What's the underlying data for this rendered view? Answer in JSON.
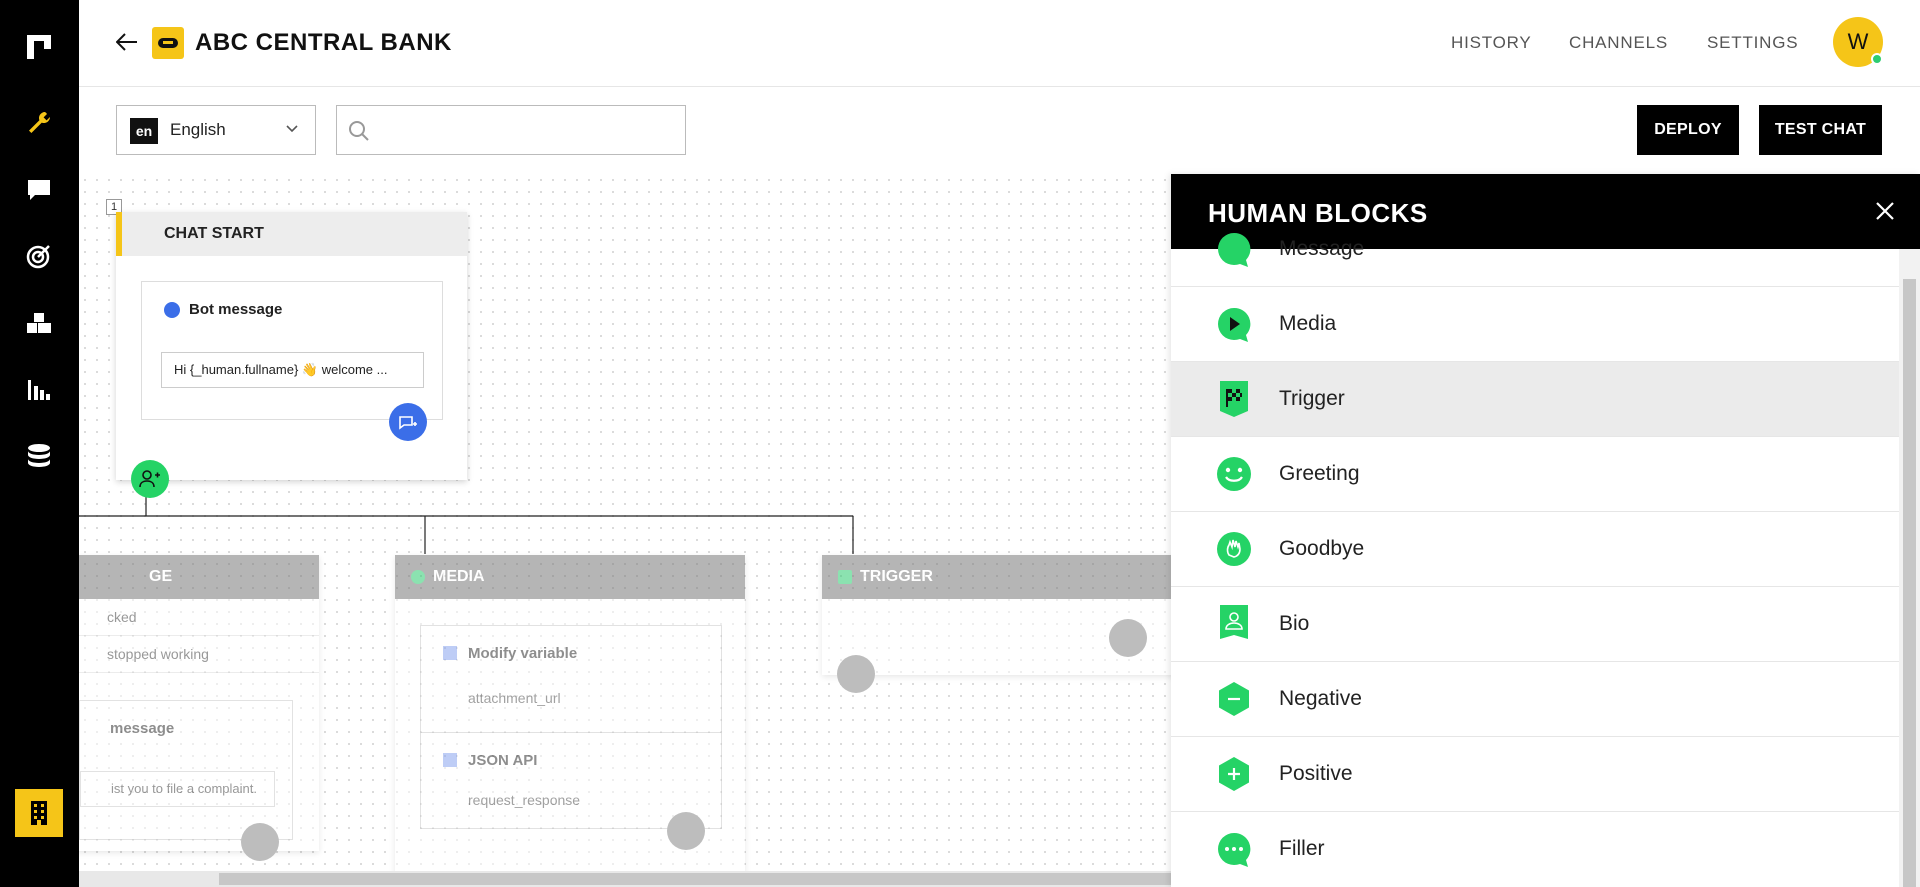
{
  "app": {
    "title": "ABC CENTRAL BANK"
  },
  "nav": {
    "history": "HISTORY",
    "channels": "CHANNELS",
    "settings": "SETTINGS",
    "avatar_initial": "W"
  },
  "toolbar": {
    "language_code": "en",
    "language": "English",
    "search_placeholder": "",
    "deploy": "DEPLOY",
    "test_chat": "TEST CHAT"
  },
  "canvas": {
    "chat_start": {
      "step": "1",
      "title": "CHAT START",
      "card_title": "Bot message",
      "message": "Hi {_human.fullname} 👋 welcome ..."
    },
    "left_node": {
      "title_fragment": "GE",
      "row1": "cked",
      "row2": "stopped working",
      "card_title": "message",
      "card_text": "ist you to file a complaint."
    },
    "media_node": {
      "title": "MEDIA",
      "item1_title": "Modify variable",
      "item1_value": "attachment_url",
      "item2_title": "JSON API",
      "item2_value": "request_response"
    },
    "trigger_node": {
      "title": "TRIGGER"
    }
  },
  "panel": {
    "title": "HUMAN BLOCKS",
    "items": [
      {
        "label": "Message",
        "icon": "message-bubble-icon"
      },
      {
        "label": "Media",
        "icon": "play-icon"
      },
      {
        "label": "Trigger",
        "icon": "checkered-flag-icon"
      },
      {
        "label": "Greeting",
        "icon": "smile-icon"
      },
      {
        "label": "Goodbye",
        "icon": "wave-hand-icon"
      },
      {
        "label": "Bio",
        "icon": "person-badge-icon"
      },
      {
        "label": "Negative",
        "icon": "minus-hexagon-icon"
      },
      {
        "label": "Positive",
        "icon": "plus-hexagon-icon"
      },
      {
        "label": "Filler",
        "icon": "ellipsis-bubble-icon"
      }
    ],
    "selected": "Trigger"
  },
  "colors": {
    "accent": "#f5c518",
    "green": "#25d366",
    "blue": "#3b6ee8",
    "dark": "#000000"
  }
}
